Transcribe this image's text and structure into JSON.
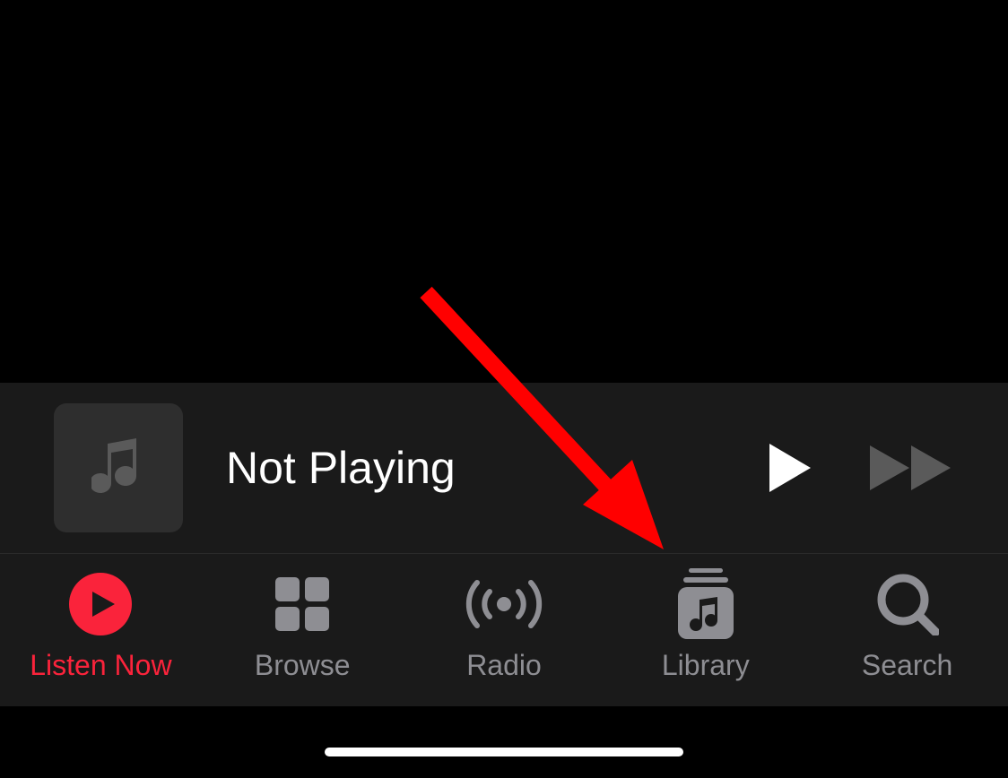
{
  "nowPlaying": {
    "status": "Not Playing"
  },
  "tabs": {
    "listenNow": {
      "label": "Listen Now",
      "active": true
    },
    "browse": {
      "label": "Browse",
      "active": false
    },
    "radio": {
      "label": "Radio",
      "active": false
    },
    "library": {
      "label": "Library",
      "active": false
    },
    "search": {
      "label": "Search",
      "active": false
    }
  },
  "colors": {
    "accent": "#fa233b",
    "inactive": "#8e8e93",
    "annotationArrow": "#ff0000"
  }
}
